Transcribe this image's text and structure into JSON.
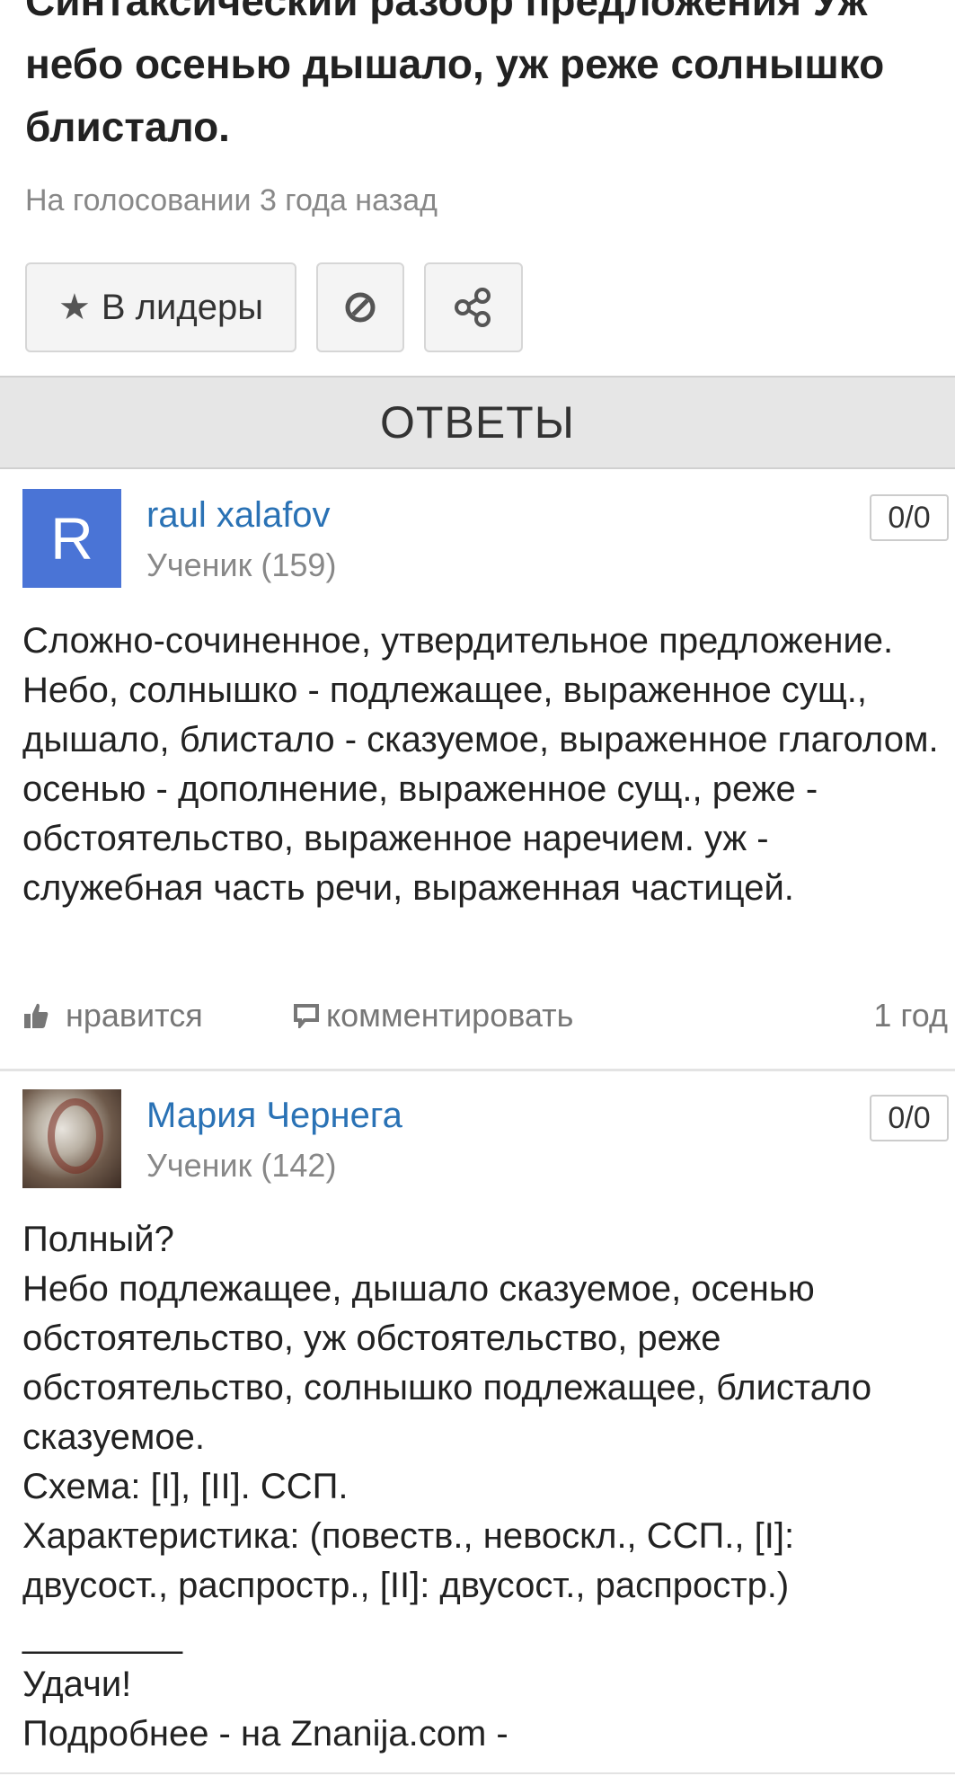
{
  "question": {
    "title": "Синтаксический разбор предложения Уж небо осенью дышало, уж реже солнышко блистало.",
    "status": "На голосовании 3 года назад",
    "leaders_button": "В лидеры"
  },
  "answers_header": "ОТВЕТЫ",
  "answers": [
    {
      "avatar_letter": "R",
      "avatar_color": "#4a74d6",
      "user_name": "raul xalafov",
      "user_rank": "Ученик (159)",
      "score": "0/0",
      "text": "Сложно-сочиненное, утвердительное предложение. Небо, солнышко - подлежащее, выраженное сущ., дышало, блистало - сказуемое, выраженное глаголом. осенью - дополнение, выраженное сущ., реже - обстоятельство, выраженное наречием. уж - служебная часть речи, выраженная частицей.",
      "like_label": "нравится",
      "comment_label": "комментировать",
      "time": "1 год"
    },
    {
      "user_name": "Мария Чернега",
      "user_rank": "Ученик (142)",
      "score": "0/0",
      "lines": [
        "Полный?",
        "Небо подлежащее, дышало сказуемое, осенью обстоятельство, уж обстоятельство, реже обстоятельство, солнышко подлежащее, блистало сказуемое.",
        "Схема: [I], [II].   ССП.",
        "Характеристика: (повеств., невоскл., ССП., [I]: двусост., распростр., [II]: двусост., распростр.)",
        "________",
        "Удачи!",
        "Подробнее - на Znanija.com -"
      ]
    }
  ],
  "icons": {
    "star": "star-icon",
    "report": "block-icon",
    "share": "share-icon",
    "like": "thumbs-up-icon",
    "comment": "comment-icon"
  },
  "colors": {
    "link": "#2a72b5",
    "muted": "#888888",
    "header_bg": "#e6e6e6"
  }
}
